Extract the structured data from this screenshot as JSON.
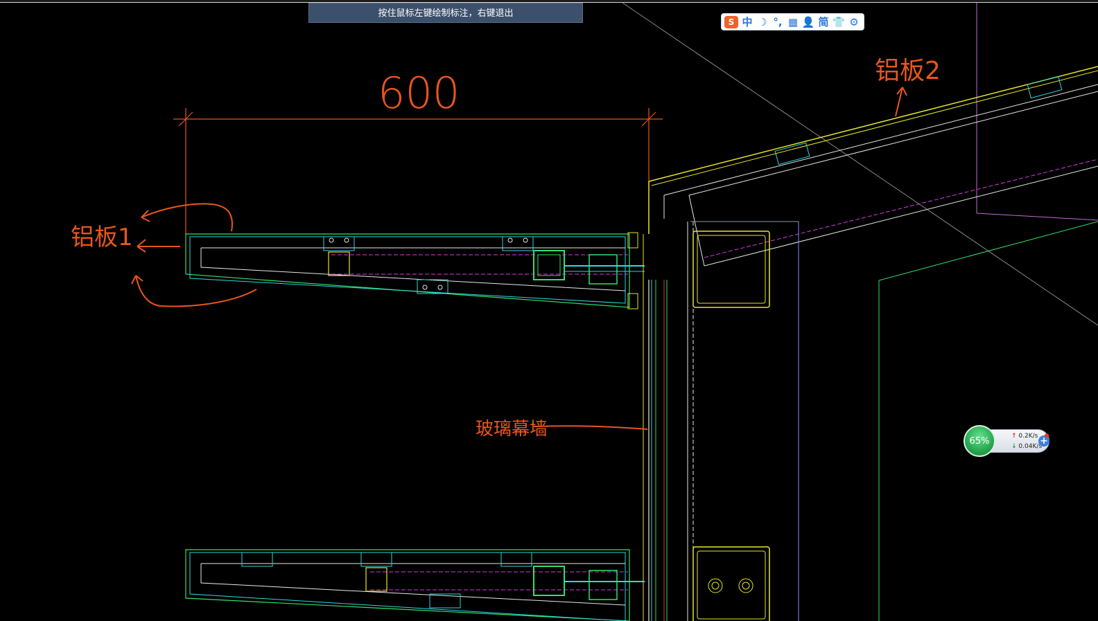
{
  "status_tip": "按住鼠标左键绘制标注，右键退出",
  "ime_toolbar": {
    "logo": "S",
    "mode": "中",
    "half_width": "☽",
    "punct": "°,",
    "keyboard": "▦",
    "user": "👤",
    "simplified": "简",
    "skin": "👕",
    "settings": "⚙"
  },
  "annotations": {
    "dimension_value": "600",
    "label_aluminum_1": "铝板1",
    "label_aluminum_2": "铝板2",
    "label_glass_curtain_wall": "玻璃幕墙"
  },
  "net_monitor": {
    "percent": "65%",
    "upload": "0.2K/s",
    "download": "0.04K/s",
    "add": "+"
  },
  "colors": {
    "cad_background": "#000000",
    "annotation_orange": "#e8561c",
    "cad_green": "#2fe26a",
    "cad_cyan": "#2fd9e0",
    "cad_yellow": "#e8e62c",
    "cad_magenta": "#d63ce0",
    "cad_white": "#e8e8e8"
  }
}
